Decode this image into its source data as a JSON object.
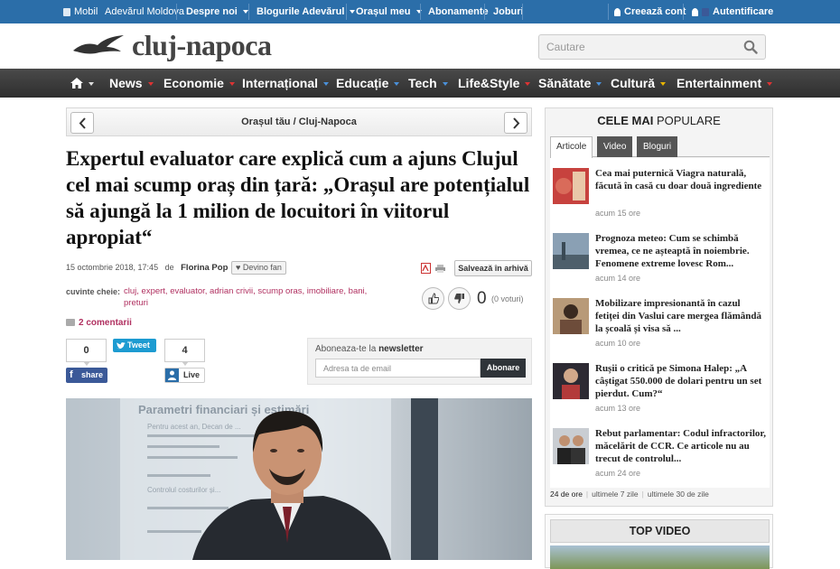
{
  "topbar": {
    "mobil": "Mobil",
    "moldova": "Adevărul Moldova",
    "despre": "Despre noi",
    "bloguri": "Blogurile Adevărul",
    "orasul": "Orașul meu",
    "abonamente": "Abonamente",
    "joburi": "Joburi",
    "creeaza": "Creează cont",
    "autentificare": "Autentificare",
    "color": "#2b6ea9"
  },
  "header": {
    "logo": "cluj-napoca",
    "search_placeholder": "Cautare"
  },
  "nav": {
    "items": [
      "News",
      "Economie",
      "Internațional",
      "Educație",
      "Tech",
      "Life&Style",
      "Sănătate",
      "Cultură",
      "Entertainment"
    ]
  },
  "article": {
    "breadcrumb": "Orașul tău / Cluj-Napoca",
    "headline": "Expertul evaluator care explică cum a ajuns Clujul cel mai scump oraș din țară: „Orașul are potențialul să ajungă la 1 milion de locuitori în viitorul apropiat“",
    "date": "15 octombrie 2018, 17:45",
    "de": "de",
    "author": "Florina Pop",
    "fan": "Devino fan",
    "save": "Salvează în arhivă",
    "tags_label": "cuvinte cheie:",
    "tags": "cluj, expert, evaluator, adrian crivii, scump oras, imobiliare, bani, preturi",
    "votes": "0",
    "votes_text": "(0 voturi)",
    "comments": "2 comentarii",
    "fb_count": "0",
    "fb_share": "share",
    "tweet": "Tweet",
    "live_count": "4",
    "live": "Live"
  },
  "newsletter": {
    "label_pre": "Aboneaza-te la ",
    "label_bold": "newsletter",
    "placeholder": "Adresa ta de email",
    "button": "Abonare"
  },
  "sidebar": {
    "title_bold": "CELE MAI",
    "title_rest": " POPULARE",
    "tabs": [
      "Articole",
      "Video",
      "Bloguri"
    ],
    "news": [
      {
        "title": "Cea mai puternică Viagra naturală, făcută în casă cu doar două ingrediente",
        "time": "acum 15 ore"
      },
      {
        "title": "Prognoza meteo: Cum se schimbă vremea, ce ne așteaptă în noiembrie. Fenomene extreme lovesc Rom...",
        "time": "acum 14 ore"
      },
      {
        "title": "Mobilizare impresionantă în cazul fetiței din Vaslui care mergea flămândă la școală și visa să ...",
        "time": "acum 10 ore"
      },
      {
        "title": "Rușii o critică pe Simona Halep: „A câștigat 550.000 de dolari pentru un set pierdut. Cum?“",
        "time": "acum 13 ore"
      },
      {
        "title": "Rebut parlamentar: Codul infractorilor, măcelărit de CCR. Ce articole nu au trecut de controlul...",
        "time": "acum 24 ore"
      }
    ],
    "periods": [
      "24 de ore",
      "ultimele 7 zile",
      "ultimele 30 de zile"
    ],
    "top_video": "TOP VIDEO"
  },
  "hero_text": {
    "l1": "Parametri financiari și estimări",
    "l2": "Pentru acest an, Decan de ...",
    "l3": "Controlul costurilor și..."
  }
}
